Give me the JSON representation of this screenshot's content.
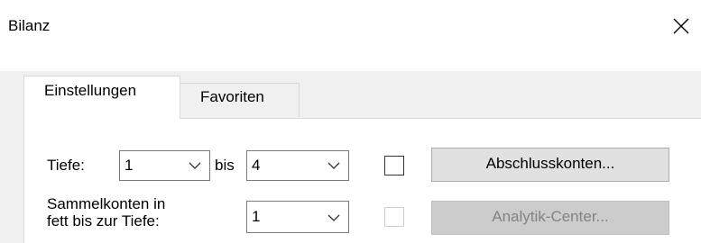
{
  "window": {
    "title": "Bilanz",
    "close_label": "Close"
  },
  "tabs": [
    {
      "label": "Einstellungen",
      "active": true
    },
    {
      "label": "Favoriten",
      "active": false
    }
  ],
  "settings": {
    "depth_label": "Tiefe:",
    "depth_from": "1",
    "to_label": "bis",
    "depth_to": "4",
    "collective_accounts_label_line1": "Sammelkonten in",
    "collective_accounts_label_line2": "fett bis zur Tiefe:",
    "bold_depth": "1",
    "closing_accounts_checked": false,
    "analytics_center_checked": false
  },
  "buttons": {
    "closing_accounts": "Abschlusskonten...",
    "analytics_center": "Analytik-Center..."
  },
  "colors": {
    "panel_background": "#ffffff",
    "dialog_background": "#f0f0f0",
    "disabled_text": "#838383"
  }
}
